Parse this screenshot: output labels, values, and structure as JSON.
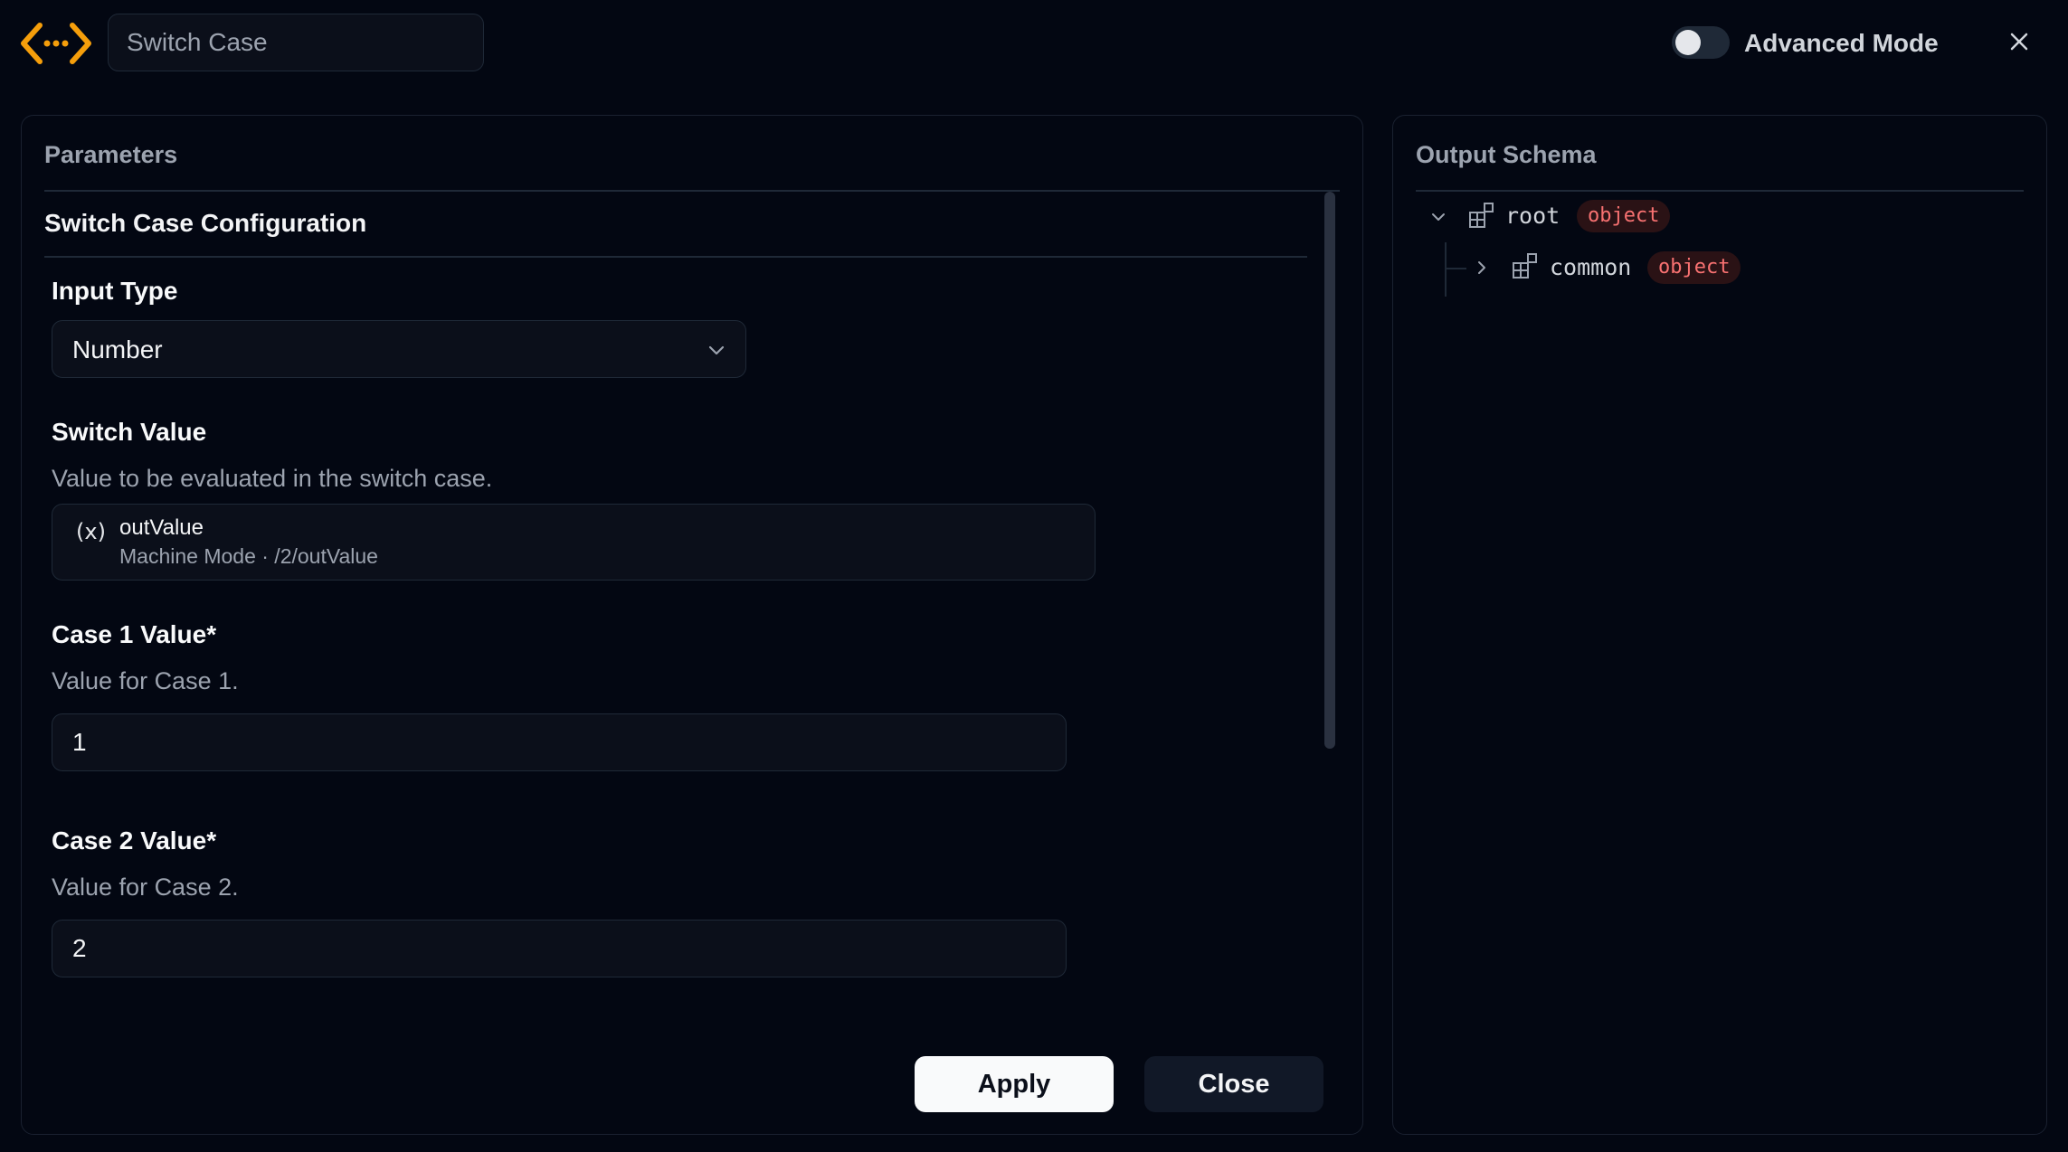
{
  "header": {
    "node_name": "Switch Case",
    "logo_icon": "code-brackets-icon",
    "advanced_mode_label": "Advanced Mode",
    "advanced_mode_on": false,
    "accent_color": "#f59e0b"
  },
  "parameters": {
    "title": "Parameters",
    "section_title": "Switch Case Configuration",
    "input_type": {
      "label": "Input Type",
      "value": "Number"
    },
    "switch_value": {
      "label": "Switch Value",
      "description": "Value to be evaluated in the switch case.",
      "variable_icon": "(x)",
      "variable_name": "outValue",
      "variable_path": "Machine Mode · /2/outValue"
    },
    "case1": {
      "label": "Case 1 Value*",
      "description": "Value for Case 1.",
      "value": "1"
    },
    "case2": {
      "label": "Case 2 Value*",
      "description": "Value for Case 2.",
      "value": "2"
    }
  },
  "actions": {
    "apply_label": "Apply",
    "close_label": "Close"
  },
  "output_schema": {
    "title": "Output Schema",
    "nodes": [
      {
        "name": "root",
        "type": "object",
        "expanded": true
      },
      {
        "name": "common",
        "type": "object",
        "expanded": false
      }
    ],
    "badge_color": "#f87171"
  }
}
